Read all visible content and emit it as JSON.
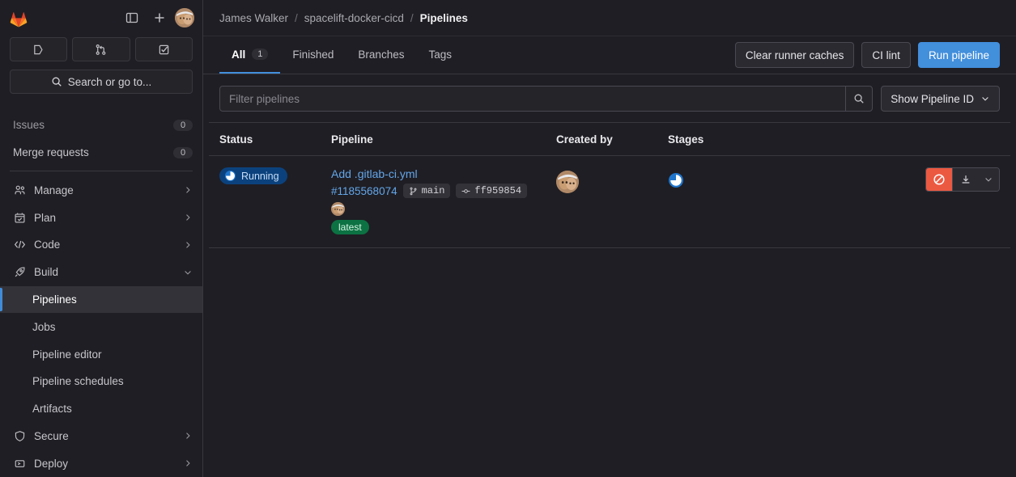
{
  "colors": {
    "accent_blue": "#428fdc",
    "link_blue": "#63a6e9",
    "running_badge_bg": "#0b427d",
    "latest_tag_bg": "#0c7243",
    "cancel_red": "#ec5941",
    "page_bg": "#1f1e24",
    "border": "#3a383f"
  },
  "sidebar": {
    "logo_name": "gitlab-logo",
    "topbar": {
      "toggle_sidebar_label": "Toggle sidebar",
      "new_label": "Create new...",
      "avatar_label": "James Walker"
    },
    "quick_actions": [
      {
        "name": "issues-icon",
        "label": "Issues"
      },
      {
        "name": "merge-requests-icon",
        "label": "Merge requests"
      },
      {
        "name": "todo-icon",
        "label": "To-Do List"
      }
    ],
    "search": {
      "label": "Search or go to...",
      "icon": "search-icon"
    },
    "counters": [
      {
        "label": "Issues",
        "count": "0"
      },
      {
        "label": "Merge requests",
        "count": "0"
      }
    ],
    "items": [
      {
        "label": "Manage",
        "icon": "users-icon",
        "chevron": "right",
        "active": false
      },
      {
        "label": "Plan",
        "icon": "calendar-icon",
        "chevron": "right",
        "active": false
      },
      {
        "label": "Code",
        "icon": "code-icon",
        "chevron": "right",
        "active": false
      },
      {
        "label": "Build",
        "icon": "rocket-icon",
        "chevron": "down",
        "active": false
      }
    ],
    "build_children": [
      {
        "label": "Pipelines",
        "active": true
      },
      {
        "label": "Jobs",
        "active": false
      },
      {
        "label": "Pipeline editor",
        "active": false
      },
      {
        "label": "Pipeline schedules",
        "active": false
      },
      {
        "label": "Artifacts",
        "active": false
      }
    ],
    "items_after": [
      {
        "label": "Secure",
        "icon": "shield-icon",
        "chevron": "right",
        "active": false
      },
      {
        "label": "Deploy",
        "icon": "deploy-icon",
        "chevron": "right",
        "active": false
      }
    ]
  },
  "breadcrumb": {
    "owner": "James Walker",
    "project": "spacelift-docker-cicd",
    "current": "Pipelines",
    "separator": "/"
  },
  "tabs": [
    {
      "label": "All",
      "badge": "1",
      "active": true
    },
    {
      "label": "Finished",
      "badge": "",
      "active": false
    },
    {
      "label": "Branches",
      "badge": "",
      "active": false
    },
    {
      "label": "Tags",
      "badge": "",
      "active": false
    }
  ],
  "toolbar": {
    "clear_caches_label": "Clear runner caches",
    "ci_lint_label": "CI lint",
    "run_pipeline_label": "Run pipeline"
  },
  "filter": {
    "placeholder": "Filter pipelines",
    "value": "",
    "search_icon": "search-icon",
    "show_pipeline_id_label": "Show Pipeline ID"
  },
  "table": {
    "columns": [
      "Status",
      "Pipeline",
      "Created by",
      "Stages"
    ],
    "rows": [
      {
        "status": "Running",
        "status_icon": "running-icon",
        "title": "Add .gitlab-ci.yml",
        "pipeline_id": "#1185568074",
        "branch": "main",
        "branch_icon": "branch-icon",
        "commit": "ff959854",
        "commit_icon": "commit-icon",
        "tag": "latest",
        "created_by_avatar": "James Walker",
        "stages": [
          {
            "name": "stage-running-icon",
            "status": "running"
          }
        ],
        "actions": {
          "cancel_label": "Cancel pipeline",
          "cancel_icon": "cancel-icon",
          "download_label": "Download artifacts",
          "download_icon": "download-icon",
          "more_icon": "chevron-down-icon"
        }
      }
    ]
  }
}
